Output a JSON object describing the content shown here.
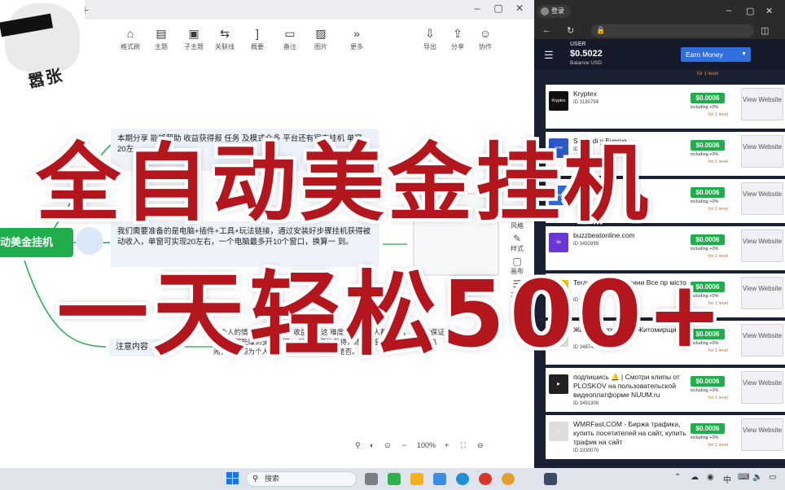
{
  "mindmap": {
    "toolbar": [
      {
        "label": "格式刷",
        "icon": "format-brush-icon",
        "glyph": "⌂"
      },
      {
        "label": "主题",
        "icon": "topic-icon",
        "glyph": "▤"
      },
      {
        "label": "子主题",
        "icon": "subtopic-icon",
        "glyph": "▣"
      },
      {
        "label": "关联线",
        "icon": "relation-line-icon",
        "glyph": "⇆"
      },
      {
        "label": "概要",
        "icon": "summary-icon",
        "glyph": "]"
      },
      {
        "label": "备注",
        "icon": "note-icon",
        "glyph": "▭"
      },
      {
        "label": "图片",
        "icon": "image-icon",
        "glyph": "▨"
      },
      {
        "label": "更多",
        "icon": "more-icon",
        "glyph": "»"
      }
    ],
    "toolbar_right": [
      {
        "label": "导出",
        "icon": "export-icon",
        "glyph": "⇩"
      },
      {
        "label": "分享",
        "icon": "share-icon",
        "glyph": "⇪"
      },
      {
        "label": "协作",
        "icon": "collaborate-icon",
        "glyph": "☺"
      }
    ],
    "root_node": "动美金挂机",
    "intro_text": "本期分享 能够帮助 收益获得报 任务 及模式众多 平台还有官方挂机 单窗 20左",
    "prep_text": "我们需要准备的是电脑+插件+工具+玩法链接，通过安装好步骤挂机获得被动收入，单窗可实现20左右，一个电脑最多开10个窗口，换算一 到。",
    "notes_label": "注意内容",
    "notes_text": "每个人的情况不同 回 每个收益。做这 难度不大 多数人都能 目，也不能保证每个人都能赚到多少利润。 所以遵理性看待，适合就尝试，不合适看看热闹，本视频为个人分析总结，请自行判断是否。",
    "side_tools": [
      {
        "label": "风格",
        "icon": "style-icon",
        "glyph": "◐"
      },
      {
        "label": "样式",
        "icon": "format-icon",
        "glyph": "✎"
      },
      {
        "label": "画布",
        "icon": "canvas-icon",
        "glyph": "▢"
      },
      {
        "label": "大纲",
        "icon": "outline-icon",
        "glyph": "☰"
      }
    ],
    "zoom": "100%"
  },
  "meme_text": "嚣张",
  "overlay": {
    "line1": "全自动美金挂机",
    "line2": "一天轻松500+"
  },
  "browser": {
    "login_label": "登录",
    "header": {
      "user_label": "USER",
      "balance": "$0.5022",
      "balance_currency": "Balance USD",
      "earn_select": "Earn Money"
    },
    "top_partial_level": "for 1 level",
    "offers": [
      {
        "name": "Kryptex",
        "id": "ID 3180794",
        "reward": "$0.0006",
        "sub": "including +0%",
        "level": "for 1 level",
        "button": "View Website",
        "logo": "Kryptex",
        "logo_color": "#111111"
      },
      {
        "name": "Se Nodi y Everve",
        "id": "ID 3",
        "reward": "$0.0006",
        "sub": "including +0%",
        "level": "for 1 level",
        "button": "View Website",
        "logo": "erve",
        "logo_color": "#2a57c9"
      },
      {
        "name": "Fa Pay",
        "id": "ID 40",
        "reward": "$0.0006",
        "sub": "including +0%",
        "level": "for 1 level",
        "button": "View Website",
        "logo": "pay",
        "logo_color": "#2c6bf0"
      },
      {
        "name": "buzzbeatonline.com",
        "id": "ID 3492899",
        "reward": "$0.0006",
        "sub": "including +0%",
        "level": "for 1 level",
        "button": "View Website",
        "logo": "bb",
        "logo_color": "#6a37d6"
      },
      {
        "name": "Terлopor aльні новини Все пр місто",
        "id": "ID 34559",
        "reward": "$0.0006",
        "sub": "including +0%",
        "level": "for 1 level",
        "button": "View Website",
        "logo": "T",
        "logo_color": "#f2c400"
      },
      {
        "name": "Житоми туристу на Житомирщині",
        "id": "ID 3487409",
        "reward": "$0.0006",
        "sub": "including +0%",
        "level": "for 1 level",
        "button": "View Website",
        "logo": "◻",
        "logo_color": "#dddddd"
      },
      {
        "name": "подпишись 🔔 | Смотри клипы от PLOSKOV на пользовательской видеоплатформе NUUM.ru",
        "id": "ID 3491306",
        "reward": "$0.0006",
        "sub": "including +0%",
        "level": "for 1 level",
        "button": "View Website",
        "logo": "▶",
        "logo_color": "#222222"
      },
      {
        "name": "WMRFast.COM - Биржа трафика, купить посетителей на сайт, купить трафик на сайт",
        "id": "ID 3330070",
        "reward": "$0.0006",
        "sub": "including +0%",
        "level": "for 1 level",
        "button": "View Website",
        "logo": "◻",
        "logo_color": "#dddddd"
      }
    ]
  },
  "taskbar": {
    "search_placeholder": "搜索",
    "tray_lang": "中"
  }
}
